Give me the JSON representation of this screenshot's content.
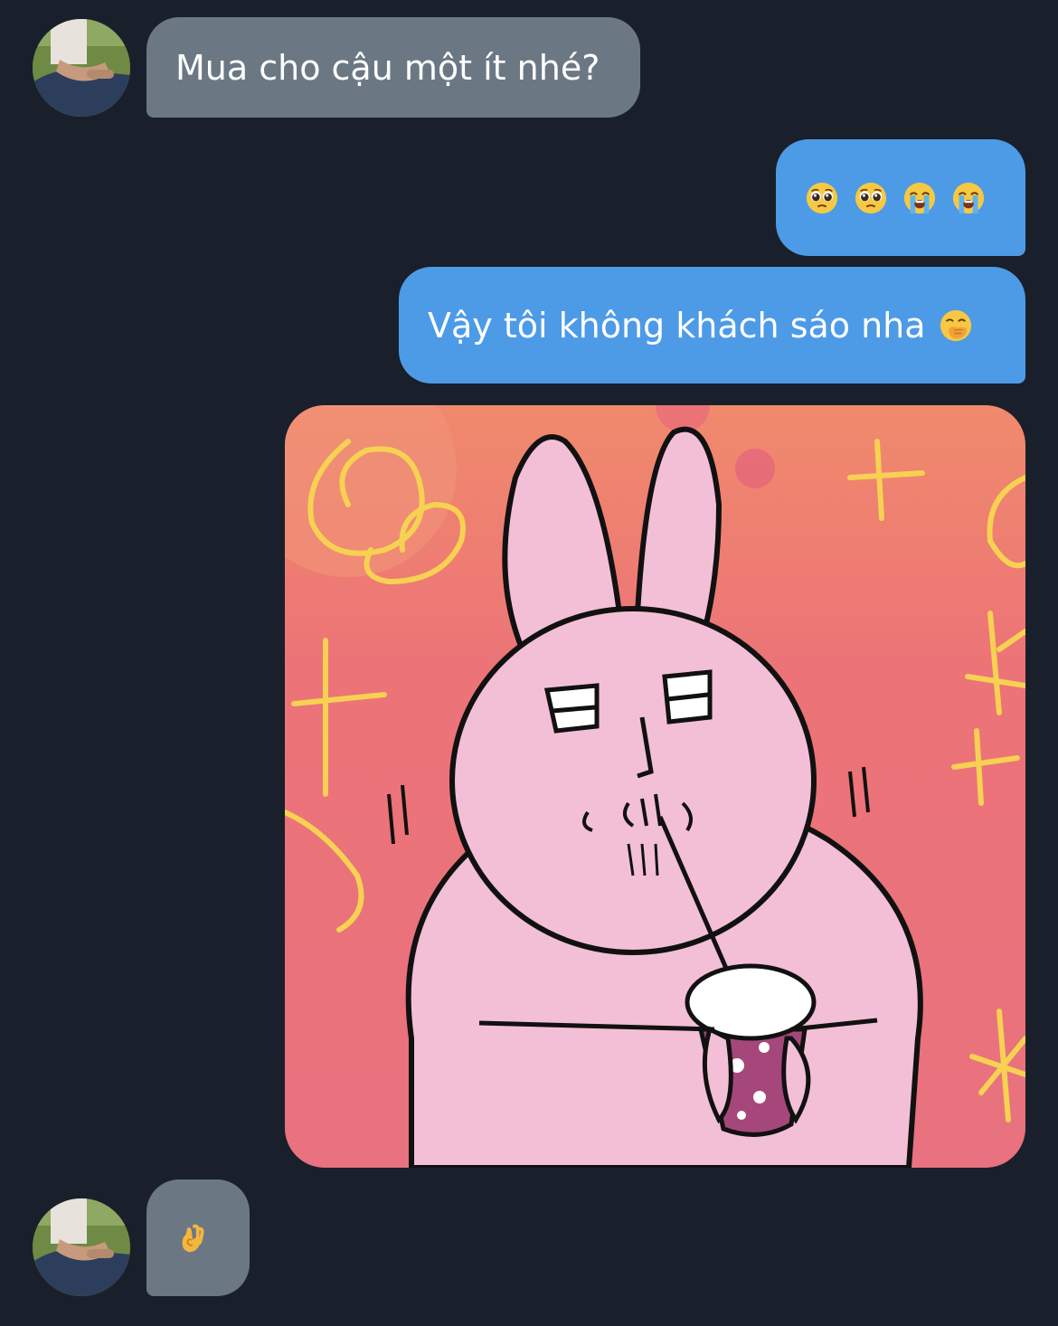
{
  "messages": [
    {
      "direction": "incoming",
      "type": "text",
      "text": "Mua cho cậu một ít nhé?"
    },
    {
      "direction": "outgoing",
      "type": "emoji",
      "emojis": [
        "pleading-face",
        "pleading-face",
        "loudly-crying-face",
        "loudly-crying-face"
      ]
    },
    {
      "direction": "outgoing",
      "type": "text",
      "text": "Vậy tôi không khách sáo nha",
      "trailing_emoji": "face-with-hand-over-mouth"
    },
    {
      "direction": "outgoing",
      "type": "sticker",
      "sticker": "pink-rabbit-drinking-bubble-tea"
    },
    {
      "direction": "incoming",
      "type": "emoji",
      "emojis": [
        "ok-hand"
      ]
    }
  ],
  "colors": {
    "background": "#19202b",
    "incoming_bubble": "#6b7884",
    "outgoing_bubble": "#4d9be6",
    "text": "#ffffff"
  }
}
